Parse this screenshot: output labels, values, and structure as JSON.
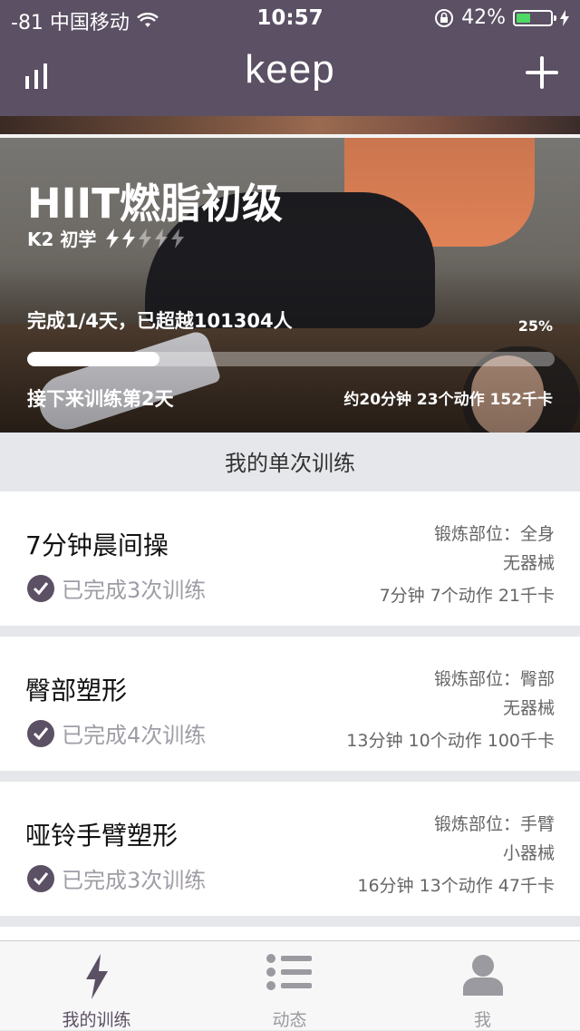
{
  "status_bar": {
    "carrier": "-81 中国移动",
    "time": "10:57",
    "battery": "42%",
    "battery_level": 0.42
  },
  "nav": {
    "logo": "keep",
    "stats_icon": "bar-chart-icon",
    "add_icon": "plus-icon"
  },
  "hero": {
    "title": "HIIT燃脂初级",
    "level": "K2 初学",
    "difficulty_filled": 2,
    "difficulty_total": 5,
    "progress_text": "完成1/4天，已超越101304人",
    "progress_pct_label": "25%",
    "progress_fraction": 0.25,
    "next_text": "接下来训练第2天",
    "meta": "约20分钟 23个动作 152千卡"
  },
  "section": {
    "title": "我的单次训练"
  },
  "workouts": [
    {
      "name": "7分钟晨间操",
      "done": "已完成3次训练",
      "part": "锻炼部位：全身",
      "equipment": "无器械",
      "stats": "7分钟 7个动作 21千卡"
    },
    {
      "name": "臀部塑形",
      "done": "已完成4次训练",
      "part": "锻炼部位：臀部",
      "equipment": "无器械",
      "stats": "13分钟 10个动作 100千卡"
    },
    {
      "name": "哑铃手臂塑形",
      "done": "已完成3次训练",
      "part": "锻炼部位：手臂",
      "equipment": "小器械",
      "stats": "16分钟 13个动作 47千卡"
    }
  ],
  "tabs": [
    {
      "label": "我的训练",
      "icon": "lightning-icon",
      "active": true
    },
    {
      "label": "动态",
      "icon": "list-icon",
      "active": false
    },
    {
      "label": "我",
      "icon": "person-icon",
      "active": false
    }
  ],
  "colors": {
    "brand": "#5b5064",
    "battery_green": "#4cd964"
  }
}
